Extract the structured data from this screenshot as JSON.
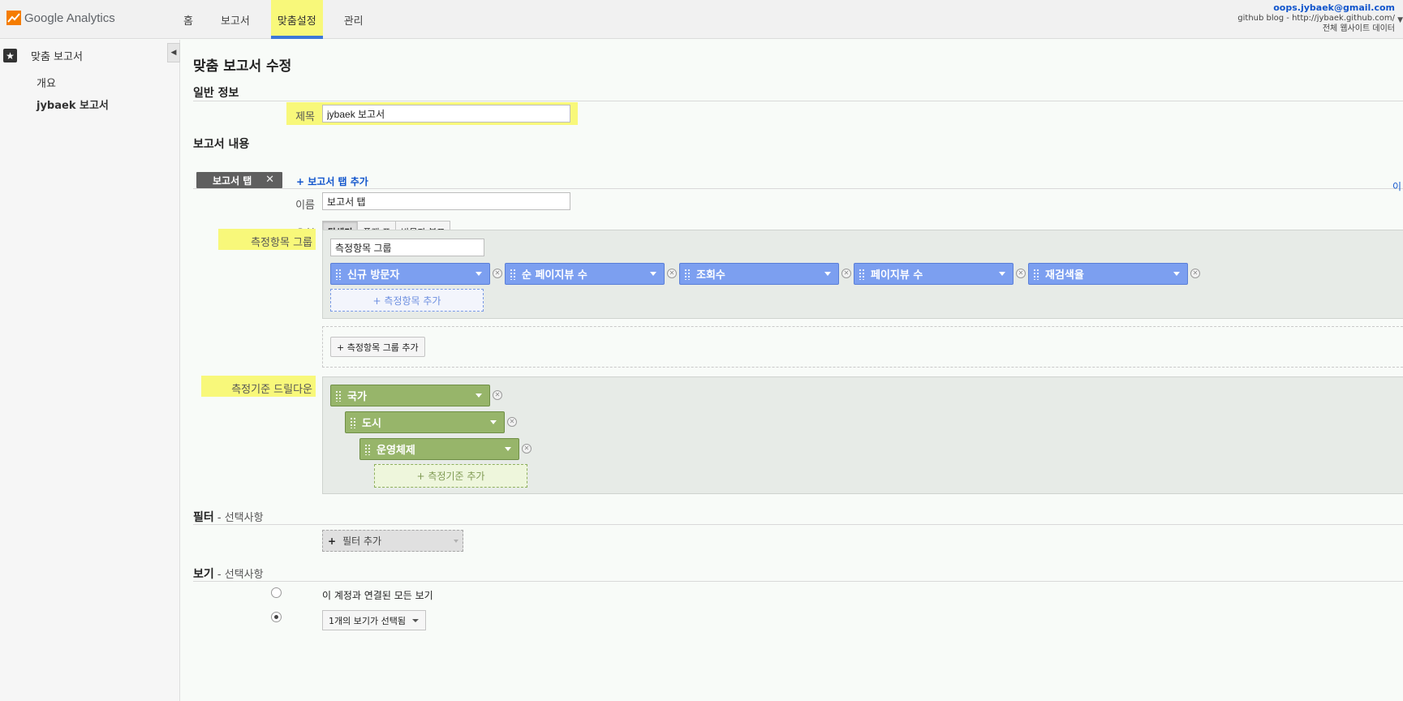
{
  "header": {
    "logo_text": "Google Analytics",
    "nav": [
      {
        "label": "홈",
        "active": false
      },
      {
        "label": "보고서",
        "active": false
      },
      {
        "label": "맞춤설정",
        "active": true
      },
      {
        "label": "관리",
        "active": false
      }
    ],
    "account": {
      "email": "oops.jybaek@gmail.com",
      "property": "github blog - http://jybaek.github.com/",
      "view": "전체 웹사이트 데이터"
    }
  },
  "sidebar": {
    "title": "맞춤 보고서",
    "items": [
      "개요",
      "jybaek 보고서"
    ],
    "icons": {
      "title": "star-icon",
      "collapse": "collapse-arrow-icon"
    }
  },
  "main": {
    "page_title": "맞춤 보고서 수정",
    "general_info": {
      "heading": "일반 정보",
      "title_label": "제목",
      "title_value": "jybaek 보고서"
    },
    "report_content": {
      "heading": "보고서 내용",
      "tab_chip": "보고서 탭",
      "add_tab": "+ 보고서 탭 추가",
      "name_label": "이름",
      "name_value": "보고서 탭",
      "type_label": "유형",
      "type_options": [
        "탐색기",
        "플랫 표",
        "방문자 분포"
      ],
      "type_selected": "탐색기",
      "edge_link": "이"
    },
    "metric_group": {
      "label": "측정항목 그룹",
      "group_name": "측정항목 그룹",
      "metrics": [
        "신규 방문자",
        "순 페이지뷰 수",
        "조회수",
        "페이지뷰 수",
        "재검색율"
      ],
      "add_metric": "+ 측정항목 추가",
      "add_group": "+ 측정항목 그룹 추가"
    },
    "dimension_drilldown": {
      "label": "측정기준 드릴다운",
      "dimensions": [
        "국가",
        "도시",
        "운영체제"
      ],
      "add_dimension": "+ 측정기준 추가"
    },
    "filter": {
      "heading": "필터",
      "optional": " - 선택사항",
      "add_filter_plus": "+",
      "add_filter": "필터 추가"
    },
    "views": {
      "heading": "보기",
      "optional": " - 선택사항",
      "option_all": "이 계정과 연결된 모든 보기",
      "selected_count": "1개의 보기가 선택됨",
      "selected_option": "selected"
    }
  },
  "colors": {
    "highlight": "#f8f87a",
    "metric_pill": "#7c9ff0",
    "dimension_pill": "#97b56a",
    "nav_active_underline": "#3d78d8",
    "link": "#1155cc"
  }
}
